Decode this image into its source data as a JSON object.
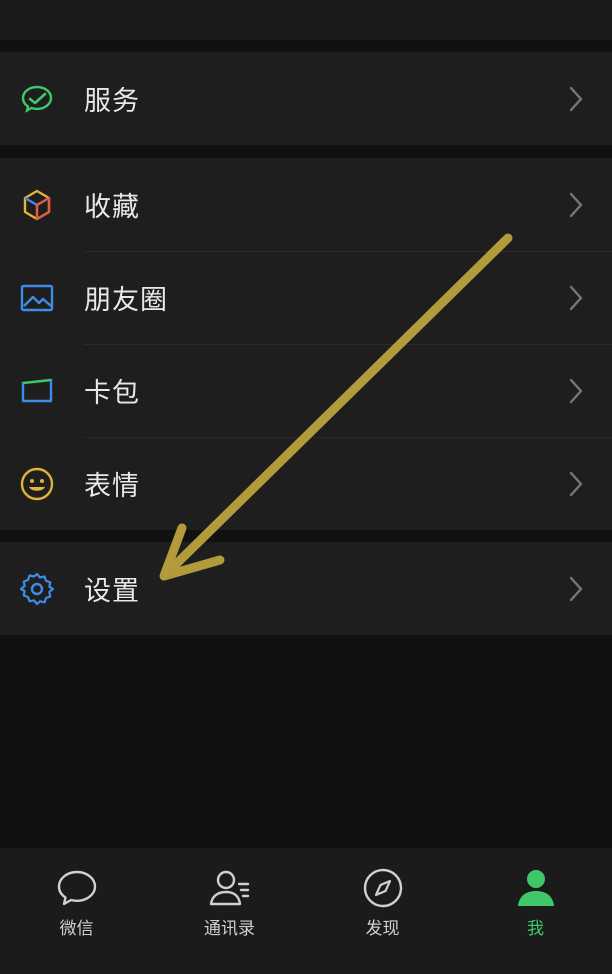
{
  "groups": [
    {
      "items": [
        {
          "label": "服务",
          "icon": "service-icon"
        }
      ]
    },
    {
      "items": [
        {
          "label": "收藏",
          "icon": "favorites-icon"
        },
        {
          "label": "朋友圈",
          "icon": "moments-icon"
        },
        {
          "label": "卡包",
          "icon": "card-wallet-icon"
        },
        {
          "label": "表情",
          "icon": "sticker-smile-icon"
        }
      ]
    },
    {
      "items": [
        {
          "label": "设置",
          "icon": "settings-gear-icon"
        }
      ]
    }
  ],
  "tabbar": [
    {
      "label": "微信",
      "icon": "chat-bubble-icon",
      "active": false
    },
    {
      "label": "通讯录",
      "icon": "contacts-icon",
      "active": false
    },
    {
      "label": "发现",
      "icon": "discover-compass-icon",
      "active": false
    },
    {
      "label": "我",
      "icon": "me-person-icon",
      "active": true
    }
  ],
  "colors": {
    "background": "#111111",
    "row_background": "#1e1e1e",
    "active_tab": "#3ec86a",
    "annotation_arrow": "#b39a3a"
  }
}
